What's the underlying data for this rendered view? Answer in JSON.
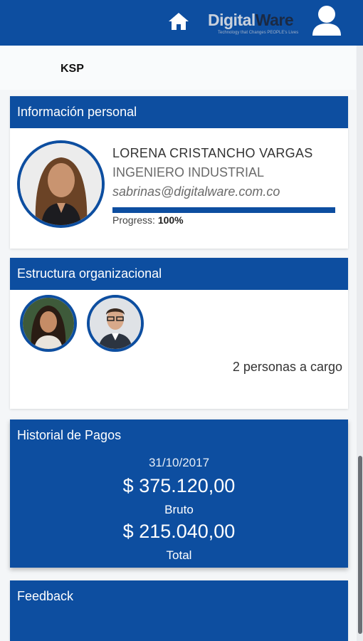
{
  "header": {
    "brand_part1": "Digital",
    "brand_part2": "Ware",
    "brand_tagline": "Technology that Changes PEOPLE's Lives",
    "home_icon": "home-icon",
    "user_icon": "user-icon"
  },
  "section_label": "KSP",
  "personal": {
    "title": "Información personal",
    "name": "LORENA CRISTANCHO VARGAS",
    "role": "INGENIERO INDUSTRIAL",
    "email": "sabrinas@digitalware.com.co",
    "progress_label": "Progress:",
    "progress_value": "100%",
    "progress_fraction": 1.0
  },
  "org": {
    "title": "Estructura organizacional",
    "count_text": "2 personas a cargo"
  },
  "pagos": {
    "title": "Historial de Pagos",
    "date": "31/10/2017",
    "gross_amount": "$ 375.120,00",
    "gross_label": "Bruto",
    "total_amount": "$ 215.040,00",
    "total_label": "Total"
  },
  "feedback": {
    "title": "Feedback"
  },
  "colors": {
    "primary": "#0d4ea0",
    "background": "#f4f6f8"
  }
}
